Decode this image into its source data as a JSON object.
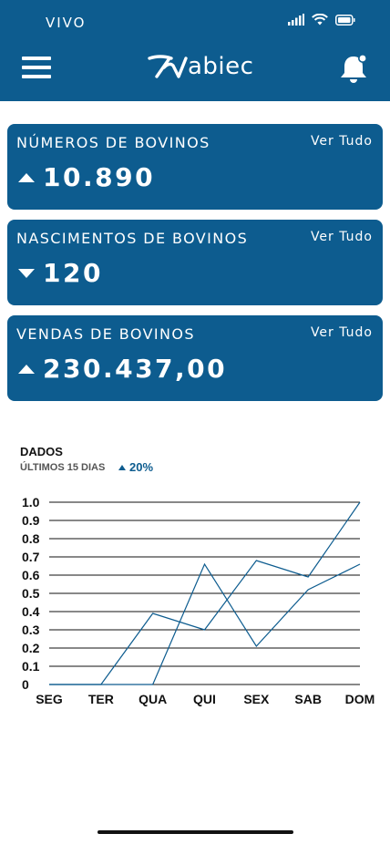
{
  "status_bar": {
    "carrier": "VIVO"
  },
  "header": {
    "logo_text": "abiec",
    "menu_icon": "hamburger-menu-icon",
    "bell_icon": "notification-bell-icon"
  },
  "cards": [
    {
      "title": "NÚMEROS DE BOVINOS",
      "link": "Ver Tudo",
      "value": "10.890",
      "trend": "up"
    },
    {
      "title": "NASCIMENTOS DE BOVINOS",
      "link": "Ver Tudo",
      "value": "120",
      "trend": "down"
    },
    {
      "title": "VENDAS DE BOVINOS",
      "link": "Ver Tudo",
      "value": "230.437,00",
      "trend": "up"
    }
  ],
  "chart": {
    "title": "DADOS",
    "subtitle": "ÚLTIMOS 15 DIAS",
    "change": "20%",
    "accent": "#0d5c8f"
  },
  "chart_data": {
    "type": "line",
    "categories": [
      "SEG",
      "TER",
      "QUA",
      "QUI",
      "SEX",
      "SAB",
      "DOM"
    ],
    "y_tick_labels": [
      "1.0",
      "0.9",
      "0.8",
      "0.7",
      "0.6",
      "0.5",
      "0.4",
      "0.3",
      "0.2",
      "0.1",
      "0"
    ],
    "ylim": [
      0,
      1
    ],
    "grid": true,
    "series": [
      {
        "values": [
          0,
          0,
          0.39,
          0.3,
          0.68,
          0.59,
          1.0
        ]
      },
      {
        "values": [
          0,
          0,
          0,
          0.66,
          0.21,
          0.52,
          0.66
        ]
      }
    ]
  }
}
